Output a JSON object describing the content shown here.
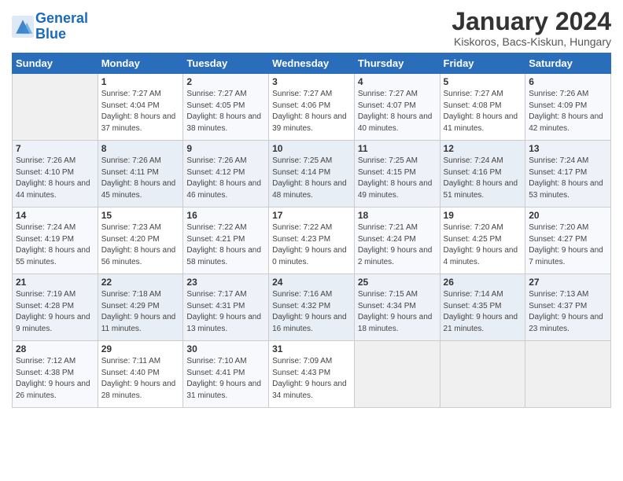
{
  "header": {
    "logo_line1": "General",
    "logo_line2": "Blue",
    "month_title": "January 2024",
    "subtitle": "Kiskoros, Bacs-Kiskun, Hungary"
  },
  "days_of_week": [
    "Sunday",
    "Monday",
    "Tuesday",
    "Wednesday",
    "Thursday",
    "Friday",
    "Saturday"
  ],
  "weeks": [
    [
      {
        "day": "",
        "sunrise": "",
        "sunset": "",
        "daylight": ""
      },
      {
        "day": "1",
        "sunrise": "Sunrise: 7:27 AM",
        "sunset": "Sunset: 4:04 PM",
        "daylight": "Daylight: 8 hours and 37 minutes."
      },
      {
        "day": "2",
        "sunrise": "Sunrise: 7:27 AM",
        "sunset": "Sunset: 4:05 PM",
        "daylight": "Daylight: 8 hours and 38 minutes."
      },
      {
        "day": "3",
        "sunrise": "Sunrise: 7:27 AM",
        "sunset": "Sunset: 4:06 PM",
        "daylight": "Daylight: 8 hours and 39 minutes."
      },
      {
        "day": "4",
        "sunrise": "Sunrise: 7:27 AM",
        "sunset": "Sunset: 4:07 PM",
        "daylight": "Daylight: 8 hours and 40 minutes."
      },
      {
        "day": "5",
        "sunrise": "Sunrise: 7:27 AM",
        "sunset": "Sunset: 4:08 PM",
        "daylight": "Daylight: 8 hours and 41 minutes."
      },
      {
        "day": "6",
        "sunrise": "Sunrise: 7:26 AM",
        "sunset": "Sunset: 4:09 PM",
        "daylight": "Daylight: 8 hours and 42 minutes."
      }
    ],
    [
      {
        "day": "7",
        "sunrise": "Sunrise: 7:26 AM",
        "sunset": "Sunset: 4:10 PM",
        "daylight": "Daylight: 8 hours and 44 minutes."
      },
      {
        "day": "8",
        "sunrise": "Sunrise: 7:26 AM",
        "sunset": "Sunset: 4:11 PM",
        "daylight": "Daylight: 8 hours and 45 minutes."
      },
      {
        "day": "9",
        "sunrise": "Sunrise: 7:26 AM",
        "sunset": "Sunset: 4:12 PM",
        "daylight": "Daylight: 8 hours and 46 minutes."
      },
      {
        "day": "10",
        "sunrise": "Sunrise: 7:25 AM",
        "sunset": "Sunset: 4:14 PM",
        "daylight": "Daylight: 8 hours and 48 minutes."
      },
      {
        "day": "11",
        "sunrise": "Sunrise: 7:25 AM",
        "sunset": "Sunset: 4:15 PM",
        "daylight": "Daylight: 8 hours and 49 minutes."
      },
      {
        "day": "12",
        "sunrise": "Sunrise: 7:24 AM",
        "sunset": "Sunset: 4:16 PM",
        "daylight": "Daylight: 8 hours and 51 minutes."
      },
      {
        "day": "13",
        "sunrise": "Sunrise: 7:24 AM",
        "sunset": "Sunset: 4:17 PM",
        "daylight": "Daylight: 8 hours and 53 minutes."
      }
    ],
    [
      {
        "day": "14",
        "sunrise": "Sunrise: 7:24 AM",
        "sunset": "Sunset: 4:19 PM",
        "daylight": "Daylight: 8 hours and 55 minutes."
      },
      {
        "day": "15",
        "sunrise": "Sunrise: 7:23 AM",
        "sunset": "Sunset: 4:20 PM",
        "daylight": "Daylight: 8 hours and 56 minutes."
      },
      {
        "day": "16",
        "sunrise": "Sunrise: 7:22 AM",
        "sunset": "Sunset: 4:21 PM",
        "daylight": "Daylight: 8 hours and 58 minutes."
      },
      {
        "day": "17",
        "sunrise": "Sunrise: 7:22 AM",
        "sunset": "Sunset: 4:23 PM",
        "daylight": "Daylight: 9 hours and 0 minutes."
      },
      {
        "day": "18",
        "sunrise": "Sunrise: 7:21 AM",
        "sunset": "Sunset: 4:24 PM",
        "daylight": "Daylight: 9 hours and 2 minutes."
      },
      {
        "day": "19",
        "sunrise": "Sunrise: 7:20 AM",
        "sunset": "Sunset: 4:25 PM",
        "daylight": "Daylight: 9 hours and 4 minutes."
      },
      {
        "day": "20",
        "sunrise": "Sunrise: 7:20 AM",
        "sunset": "Sunset: 4:27 PM",
        "daylight": "Daylight: 9 hours and 7 minutes."
      }
    ],
    [
      {
        "day": "21",
        "sunrise": "Sunrise: 7:19 AM",
        "sunset": "Sunset: 4:28 PM",
        "daylight": "Daylight: 9 hours and 9 minutes."
      },
      {
        "day": "22",
        "sunrise": "Sunrise: 7:18 AM",
        "sunset": "Sunset: 4:29 PM",
        "daylight": "Daylight: 9 hours and 11 minutes."
      },
      {
        "day": "23",
        "sunrise": "Sunrise: 7:17 AM",
        "sunset": "Sunset: 4:31 PM",
        "daylight": "Daylight: 9 hours and 13 minutes."
      },
      {
        "day": "24",
        "sunrise": "Sunrise: 7:16 AM",
        "sunset": "Sunset: 4:32 PM",
        "daylight": "Daylight: 9 hours and 16 minutes."
      },
      {
        "day": "25",
        "sunrise": "Sunrise: 7:15 AM",
        "sunset": "Sunset: 4:34 PM",
        "daylight": "Daylight: 9 hours and 18 minutes."
      },
      {
        "day": "26",
        "sunrise": "Sunrise: 7:14 AM",
        "sunset": "Sunset: 4:35 PM",
        "daylight": "Daylight: 9 hours and 21 minutes."
      },
      {
        "day": "27",
        "sunrise": "Sunrise: 7:13 AM",
        "sunset": "Sunset: 4:37 PM",
        "daylight": "Daylight: 9 hours and 23 minutes."
      }
    ],
    [
      {
        "day": "28",
        "sunrise": "Sunrise: 7:12 AM",
        "sunset": "Sunset: 4:38 PM",
        "daylight": "Daylight: 9 hours and 26 minutes."
      },
      {
        "day": "29",
        "sunrise": "Sunrise: 7:11 AM",
        "sunset": "Sunset: 4:40 PM",
        "daylight": "Daylight: 9 hours and 28 minutes."
      },
      {
        "day": "30",
        "sunrise": "Sunrise: 7:10 AM",
        "sunset": "Sunset: 4:41 PM",
        "daylight": "Daylight: 9 hours and 31 minutes."
      },
      {
        "day": "31",
        "sunrise": "Sunrise: 7:09 AM",
        "sunset": "Sunset: 4:43 PM",
        "daylight": "Daylight: 9 hours and 34 minutes."
      },
      {
        "day": "",
        "sunrise": "",
        "sunset": "",
        "daylight": ""
      },
      {
        "day": "",
        "sunrise": "",
        "sunset": "",
        "daylight": ""
      },
      {
        "day": "",
        "sunrise": "",
        "sunset": "",
        "daylight": ""
      }
    ]
  ]
}
